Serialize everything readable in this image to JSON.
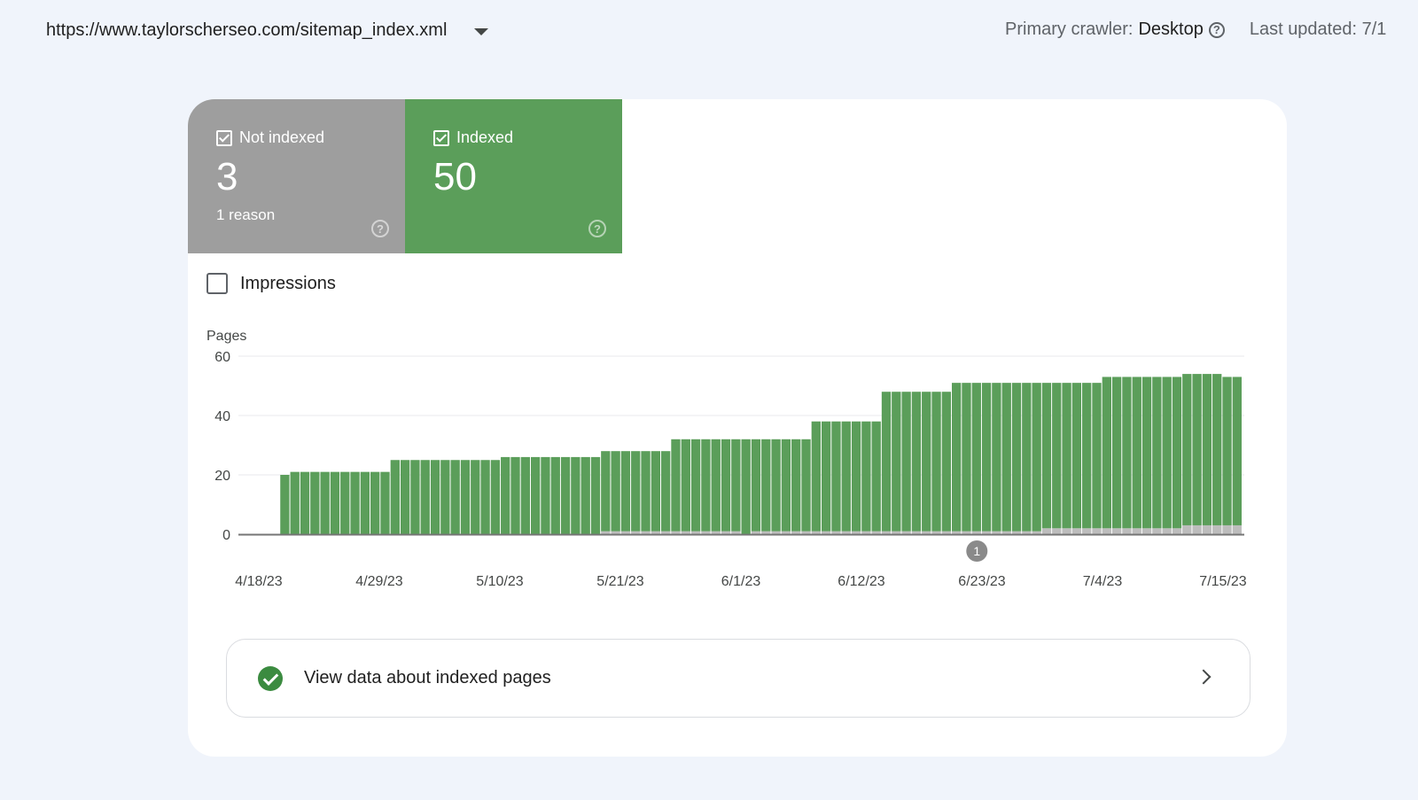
{
  "topbar": {
    "sitemap_url": "https://www.taylorscherseo.com/sitemap_index.xml",
    "crawler_label": "Primary crawler:",
    "crawler_value": "Desktop",
    "last_updated": "Last updated: 7/1"
  },
  "metrics": {
    "not_indexed": {
      "label": "Not indexed",
      "value": "3",
      "reason": "1 reason",
      "color": "#9e9e9e"
    },
    "indexed": {
      "label": "Indexed",
      "value": "50",
      "color": "#5b9e5a"
    }
  },
  "impressions": {
    "label": "Impressions",
    "checked": false
  },
  "chart_data": {
    "type": "bar",
    "stacked": true,
    "ylabel": "Pages",
    "ylim": [
      0,
      60
    ],
    "yticks": [
      0,
      20,
      40,
      60
    ],
    "xtick_labels": [
      "4/18/23",
      "4/29/23",
      "5/10/23",
      "5/21/23",
      "6/1/23",
      "6/12/23",
      "6/23/23",
      "7/4/23",
      "7/15/23"
    ],
    "start_date": "4/18/23",
    "end_date": "7/15/23",
    "grid": true,
    "annotation": {
      "label": "1",
      "date": "6/30/23"
    },
    "series": [
      {
        "name": "Indexed",
        "color": "#5b9e5a",
        "values": [
          0,
          0,
          0,
          0,
          20,
          21,
          21,
          21,
          21,
          21,
          21,
          21,
          21,
          21,
          21,
          25,
          25,
          25,
          25,
          25,
          25,
          25,
          25,
          25,
          25,
          25,
          26,
          26,
          26,
          26,
          26,
          26,
          26,
          26,
          26,
          26,
          27,
          27,
          27,
          27,
          27,
          27,
          27,
          31,
          31,
          31,
          31,
          31,
          31,
          31,
          32,
          31,
          31,
          31,
          31,
          31,
          31,
          37,
          37,
          37,
          37,
          37,
          37,
          37,
          47,
          47,
          47,
          47,
          47,
          47,
          47,
          50,
          50,
          50,
          50,
          50,
          50,
          50,
          50,
          50,
          49,
          49,
          49,
          49,
          49,
          49,
          51,
          51,
          51,
          51,
          51,
          51,
          51,
          51,
          51,
          51,
          51,
          51,
          50,
          50
        ]
      },
      {
        "name": "Not indexed",
        "color": "#bdbdbd",
        "values": [
          0,
          0,
          0,
          0,
          0,
          0,
          0,
          0,
          0,
          0,
          0,
          0,
          0,
          0,
          0,
          0,
          0,
          0,
          0,
          0,
          0,
          0,
          0,
          0,
          0,
          0,
          0,
          0,
          0,
          0,
          0,
          0,
          0,
          0,
          0,
          0,
          1,
          1,
          1,
          1,
          1,
          1,
          1,
          1,
          1,
          1,
          1,
          1,
          1,
          1,
          0,
          1,
          1,
          1,
          1,
          1,
          1,
          1,
          1,
          1,
          1,
          1,
          1,
          1,
          1,
          1,
          1,
          1,
          1,
          1,
          1,
          1,
          1,
          1,
          1,
          1,
          1,
          1,
          1,
          1,
          2,
          2,
          2,
          2,
          2,
          2,
          2,
          2,
          2,
          2,
          2,
          2,
          2,
          2,
          3,
          3,
          3,
          3,
          3,
          3
        ]
      }
    ]
  },
  "view_link": {
    "label": "View data about indexed pages"
  }
}
